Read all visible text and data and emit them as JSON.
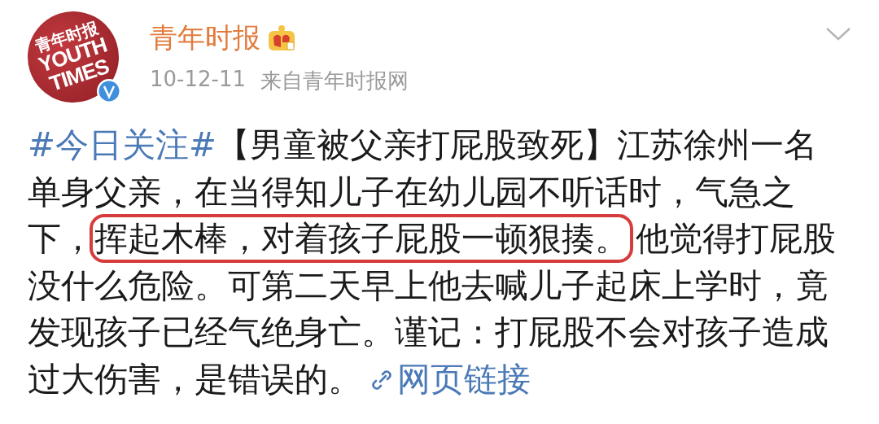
{
  "author": {
    "avatar_logo": [
      "青年时报",
      "YOUTH",
      "TIMES"
    ],
    "verified": true,
    "name": "青年时报",
    "member_crown": true,
    "time": "10-12-11",
    "source": "来自青年时报网"
  },
  "post": {
    "segments": [
      {
        "kind": "topic",
        "text": "#今日关注#"
      },
      {
        "kind": "plain",
        "text": "【男童被父亲打屁股致死】江苏徐州一名单身父亲，在当得知儿子在幼儿园不听话时，气急之下，"
      },
      {
        "kind": "highlight",
        "text": "挥起木棒，对着孩子屁股一顿狠揍。"
      },
      {
        "kind": "plain",
        "text": "他觉得打屁股没什么危险。可第二天早上他去喊儿子起床上学时，竟发现孩子已经气绝身亡。谨记：打屁股不会对孩子造成过大伤害，是错误的。"
      },
      {
        "kind": "link",
        "text": "网页链接"
      }
    ]
  }
}
